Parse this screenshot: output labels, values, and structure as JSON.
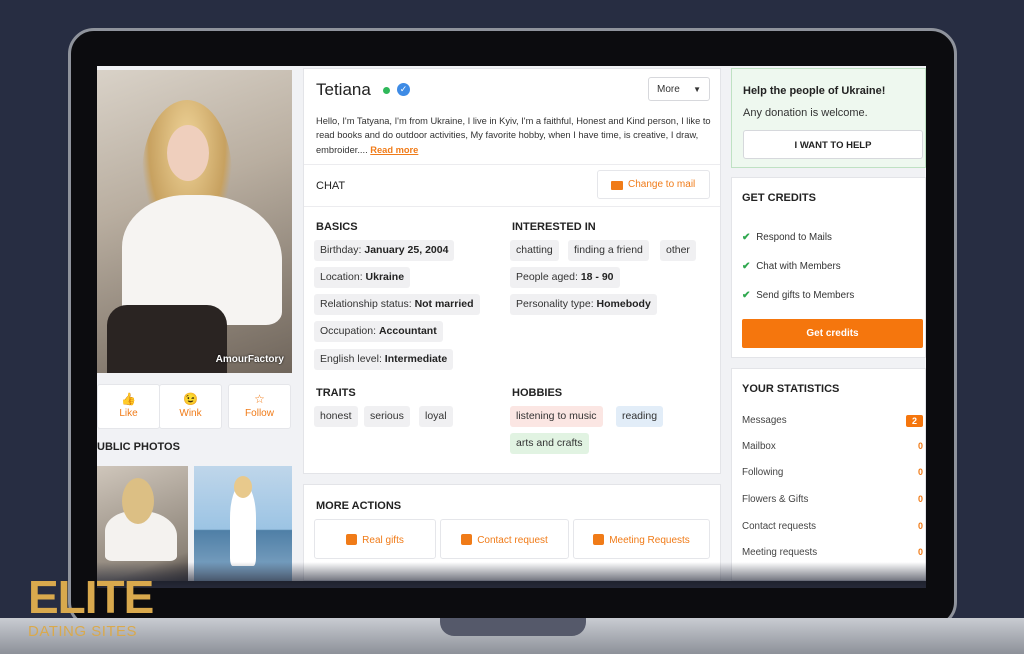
{
  "profile": {
    "name": "Tetiana",
    "more_label": "More",
    "bio": "Hello, I'm Tatyana, I'm from Ukraine, I live in Kyiv, I'm a faithful, Honest and Kind person, I like to read books and do outdoor activities, My favorite hobby, when I have time, is creative, I draw, embroider....",
    "read_more": "Read more",
    "photo_watermark": "AmourFactory"
  },
  "actions": {
    "like": "Like",
    "wink": "Wink",
    "follow": "Follow"
  },
  "public_photos_title": "UBLIC PHOTOS",
  "chat": {
    "label": "CHAT",
    "change_to_mail": "Change to mail"
  },
  "basics": {
    "title": "BASICS",
    "items": [
      {
        "label": "Birthday:",
        "value": "January 25, 2004"
      },
      {
        "label": "Location:",
        "value": "Ukraine"
      },
      {
        "label": "Relationship status:",
        "value": "Not married"
      },
      {
        "label": "Occupation:",
        "value": "Accountant"
      },
      {
        "label": "English level:",
        "value": "Intermediate"
      }
    ]
  },
  "interested_in": {
    "title": "INTERESTED IN",
    "tags": [
      "chatting",
      "finding a friend",
      "other"
    ],
    "people_aged_label": "People aged:",
    "people_aged_value": "18 - 90",
    "personality_label": "Personality type:",
    "personality_value": "Homebody"
  },
  "traits": {
    "title": "TRAITS",
    "tags": [
      "honest",
      "serious",
      "loyal"
    ]
  },
  "hobbies": {
    "title": "HOBBIES",
    "tags": [
      "listening to music",
      "reading",
      "arts and crafts"
    ]
  },
  "more_actions": {
    "title": "MORE ACTIONS",
    "buttons": [
      "Real gifts",
      "Contact request",
      "Meeting Requests"
    ]
  },
  "help": {
    "title": "Help the people of Ukraine!",
    "subtitle": "Any donation is welcome.",
    "button": "I WANT TO HELP"
  },
  "credits": {
    "title": "GET CREDITS",
    "items": [
      "Respond to Mails",
      "Chat with Members",
      "Send gifts to Members"
    ],
    "button": "Get credits"
  },
  "statistics": {
    "title": "YOUR STATISTICS",
    "rows": [
      {
        "label": "Messages",
        "value": "2"
      },
      {
        "label": "Mailbox",
        "value": "0"
      },
      {
        "label": "Following",
        "value": "0"
      },
      {
        "label": "Flowers & Gifts",
        "value": "0"
      },
      {
        "label": "Contact requests",
        "value": "0"
      },
      {
        "label": "Meeting requests",
        "value": "0"
      }
    ]
  },
  "logo": {
    "main": "ELITE",
    "sub": "DATING SITES"
  },
  "colors": {
    "accent": "#f07b18",
    "background": "#272d42",
    "online": "#2fb85a",
    "verified": "#3e8be5",
    "logo": "#d9a94d"
  }
}
